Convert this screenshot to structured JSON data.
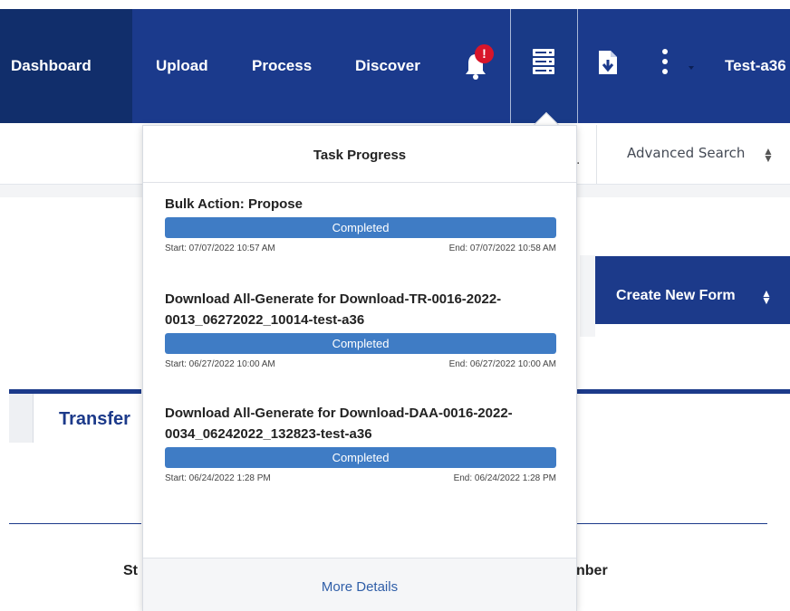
{
  "nav": {
    "items": [
      {
        "label": "Dashboard"
      },
      {
        "label": "Upload"
      },
      {
        "label": "Process"
      },
      {
        "label": "Discover"
      }
    ],
    "notification_badge": "!",
    "user_label": "Test-a36",
    "icons": {
      "notifications": "bell-icon",
      "tasks": "task-list-icon",
      "downloads": "file-download-icon",
      "more": "kebab-menu-icon"
    },
    "colors": {
      "nav_bg": "#1b3a8c",
      "active_bg": "#112e6b",
      "badge": "#d8152a"
    }
  },
  "page": {
    "advanced_search_label": "Advanced Search",
    "create_button_label": "Create New Form",
    "transfer_tab_label": "Transfer",
    "column_fragment_left": "St",
    "column_fragment_right": "nber",
    "fragment_dot": "."
  },
  "task_panel": {
    "title": "Task Progress",
    "tasks": [
      {
        "title": "Bulk Action: Propose",
        "status": "Completed",
        "progress": 1.0,
        "start": "Start: 07/07/2022 10:57 AM",
        "end": "End: 07/07/2022 10:58 AM"
      },
      {
        "title": "Download All-Generate for Download-TR-0016-2022-0013_06272022_10014-test-a36",
        "status": "Completed",
        "progress": 1.0,
        "start": "Start: 06/27/2022 10:00 AM",
        "end": "End: 06/27/2022 10:00 AM"
      },
      {
        "title": "Download All-Generate for Download-DAA-0016-2022-0034_06242022_132823-test-a36",
        "status": "Completed",
        "progress": 1.0,
        "start": "Start: 06/24/2022 1:28 PM",
        "end": "End: 06/24/2022 1:28 PM"
      }
    ],
    "footer_label": "More Details",
    "colors": {
      "bar": "#3f7cc5"
    }
  }
}
